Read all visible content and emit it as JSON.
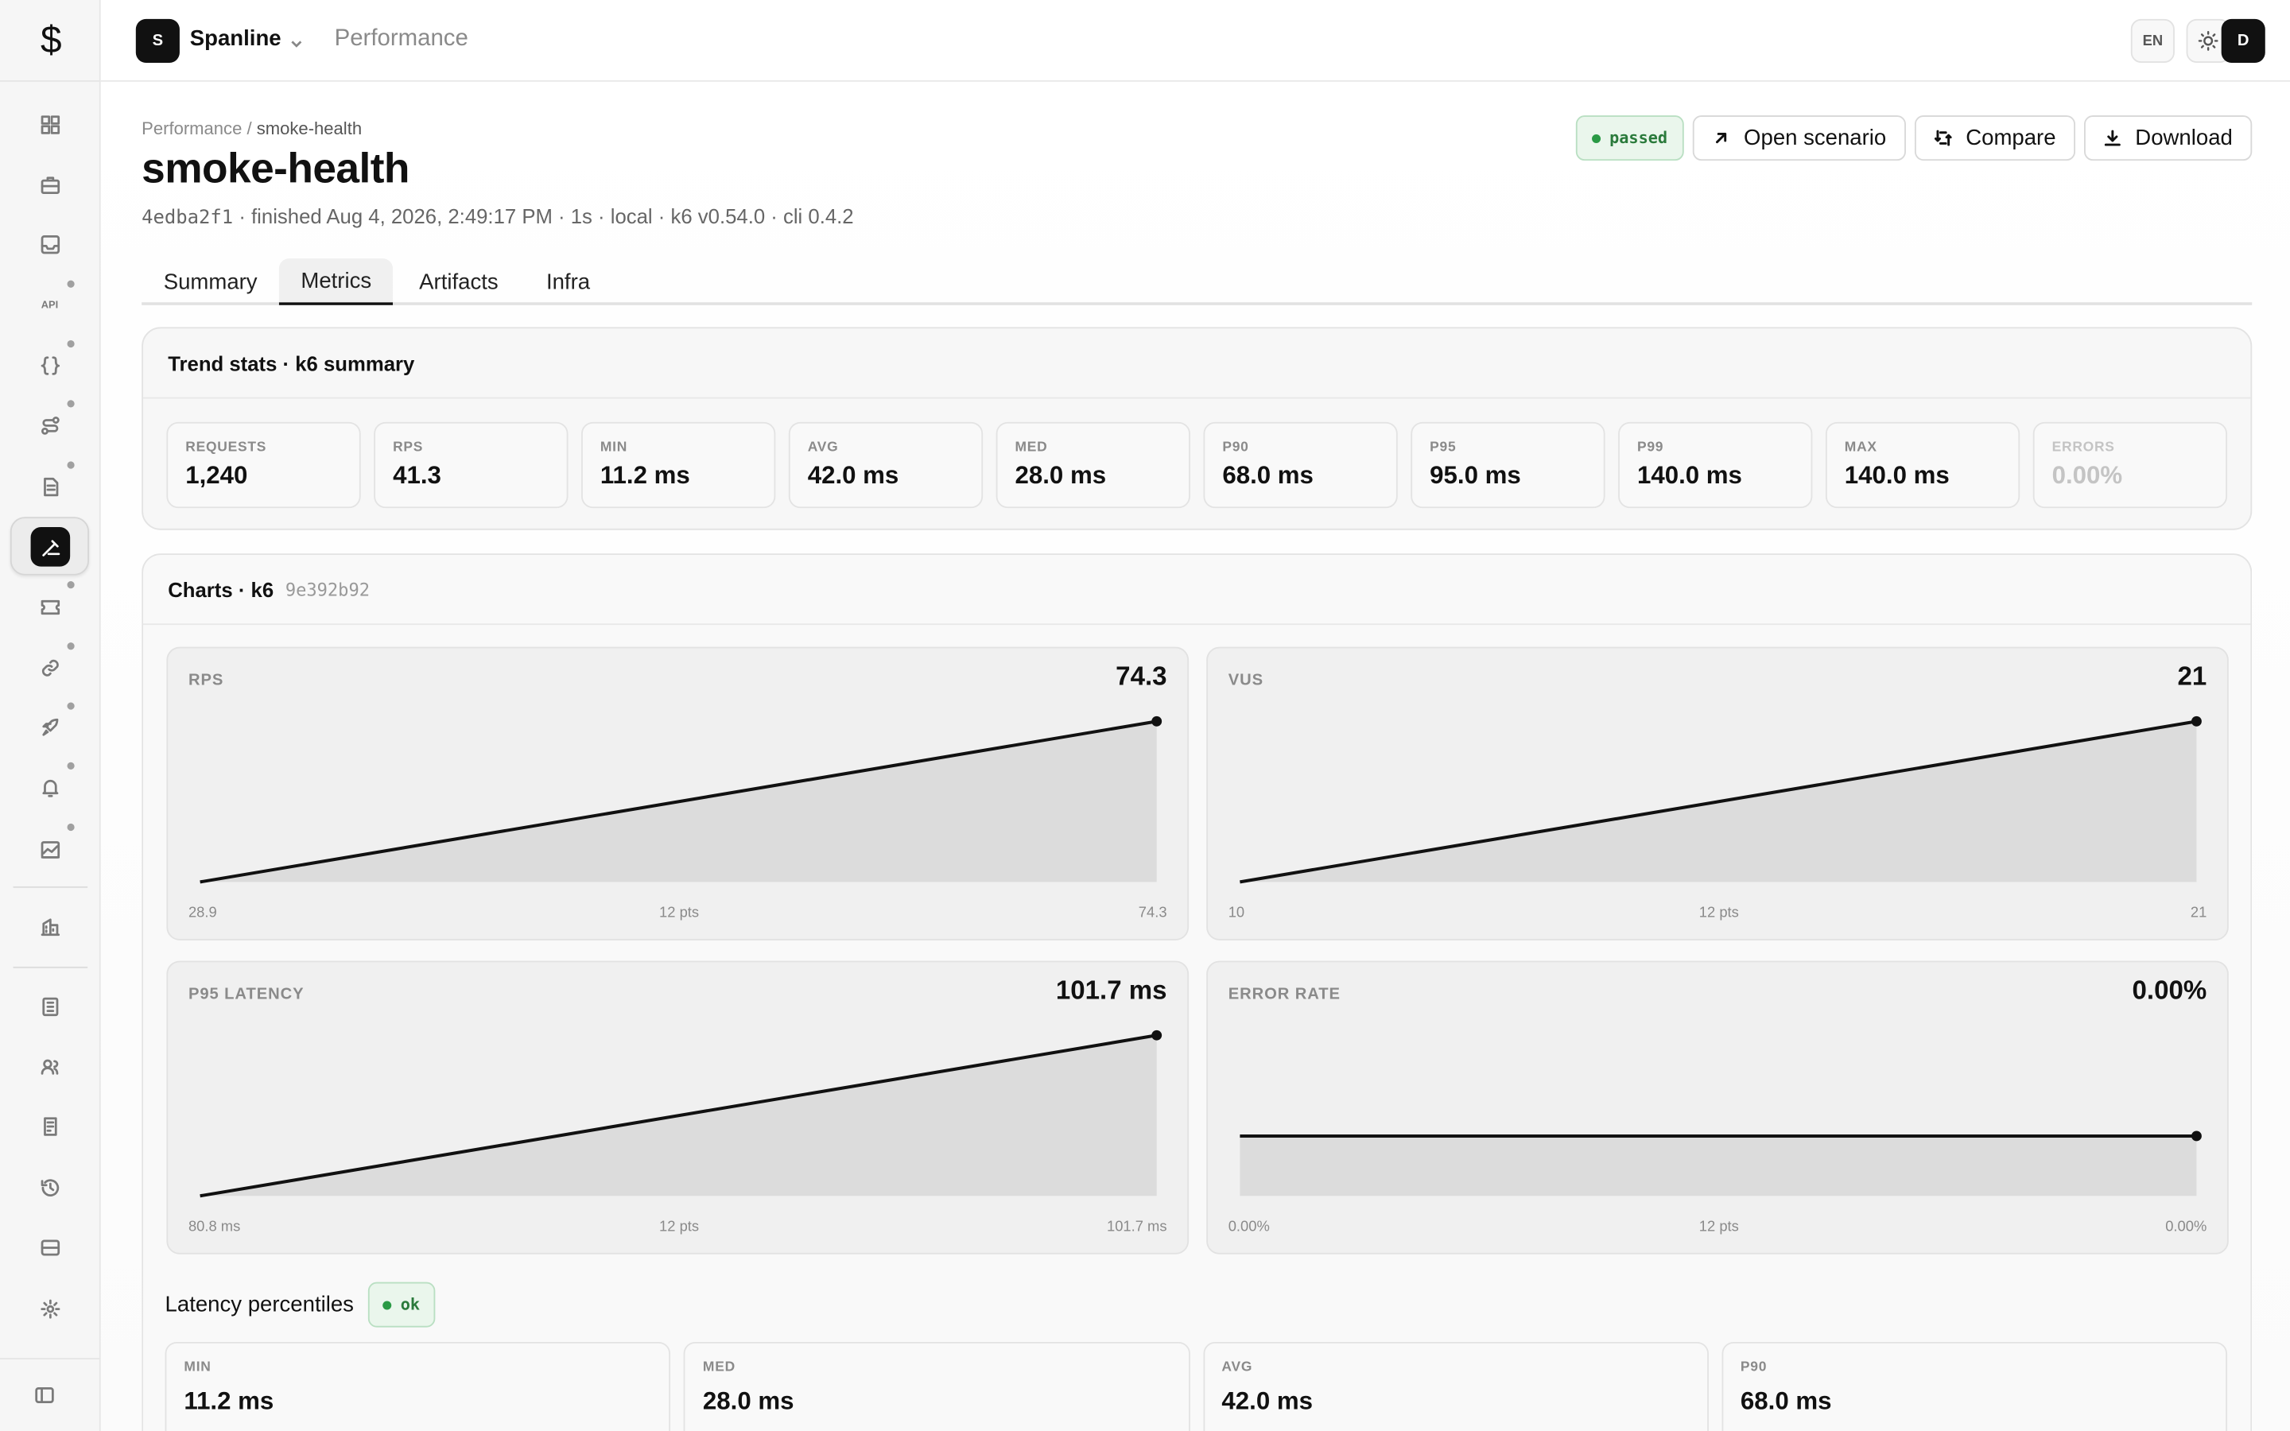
{
  "app": {
    "logo": "$",
    "workspace_initial": "S",
    "workspace": "Spanline",
    "section": "Performance"
  },
  "topbar": {
    "lang": "EN",
    "avatar": "D"
  },
  "sidebar": {
    "items": [
      {
        "name": "dashboard",
        "icon": "grid-icon"
      },
      {
        "name": "briefcase",
        "icon": "briefcase-icon"
      },
      {
        "name": "inbox",
        "icon": "inbox-icon"
      },
      {
        "name": "api",
        "icon": "api-icon",
        "label": "API"
      },
      {
        "name": "code",
        "icon": "braces-icon"
      },
      {
        "name": "workflow",
        "icon": "route-icon"
      },
      {
        "name": "docs",
        "icon": "file-icon"
      },
      {
        "name": "performance",
        "icon": "gauge-icon",
        "active": true
      },
      {
        "name": "tickets",
        "icon": "ticket-icon"
      },
      {
        "name": "links",
        "icon": "link-icon"
      },
      {
        "name": "deploy",
        "icon": "rocket-icon"
      },
      {
        "name": "alerts",
        "icon": "bell-icon"
      },
      {
        "name": "analytics",
        "icon": "chart-icon"
      },
      {
        "name": "buildings",
        "icon": "building-icon"
      },
      {
        "name": "ledger",
        "icon": "ledger-icon"
      },
      {
        "name": "users",
        "icon": "users-icon"
      },
      {
        "name": "reports",
        "icon": "report-icon"
      },
      {
        "name": "history",
        "icon": "history-icon"
      },
      {
        "name": "storage",
        "icon": "storage-icon"
      },
      {
        "name": "settings",
        "icon": "gear-icon"
      },
      {
        "name": "collapse",
        "icon": "sidebar-toggle-icon"
      }
    ]
  },
  "page": {
    "crumb_parent": "Performance",
    "crumb_sep": "/",
    "crumb_current": "smoke-health",
    "title": "smoke-health",
    "meta_hash": "4edba2f1",
    "meta_rest": " · finished Aug 4, 2026, 2:49:17 PM · 1s · local · k6 v0.54.0 · cli 0.4.2",
    "status": "passed",
    "actions": {
      "open": "Open scenario",
      "compare": "Compare",
      "download": "Download"
    },
    "tabs": [
      "Summary",
      "Metrics",
      "Artifacts",
      "Infra"
    ]
  },
  "trend": {
    "title": "Trend stats · k6 summary",
    "stats": [
      {
        "label": "REQUESTS",
        "value": "1,240"
      },
      {
        "label": "RPS",
        "value": "41.3"
      },
      {
        "label": "MIN",
        "value": "11.2 ms"
      },
      {
        "label": "AVG",
        "value": "42.0 ms"
      },
      {
        "label": "MED",
        "value": "28.0 ms"
      },
      {
        "label": "P90",
        "value": "68.0 ms"
      },
      {
        "label": "P95",
        "value": "95.0 ms"
      },
      {
        "label": "P99",
        "value": "140.0 ms"
      },
      {
        "label": "MAX",
        "value": "140.0 ms"
      },
      {
        "label": "ERRORS",
        "value": "0.00%"
      }
    ]
  },
  "charts": {
    "title": "Charts · k6",
    "hash": "9e392b92",
    "cards": [
      {
        "label": "RPS",
        "value": "74.3",
        "axis_min": "28.9",
        "axis_mid": "12 pts",
        "axis_max": "74.3",
        "start": 28.9,
        "end": 74.3
      },
      {
        "label": "VUS",
        "value": "21",
        "axis_min": "10",
        "axis_mid": "12 pts",
        "axis_max": "21",
        "start": 10,
        "end": 21
      },
      {
        "label": "P95 LATENCY",
        "value": "101.7 ms",
        "axis_min": "80.8 ms",
        "axis_mid": "12 pts",
        "axis_max": "101.7 ms",
        "start": 80.8,
        "end": 101.7
      },
      {
        "label": "ERROR RATE",
        "value": "0.00%",
        "axis_min": "0.00%",
        "axis_mid": "12 pts",
        "axis_max": "0.00%",
        "start": 0,
        "end": 0
      }
    ]
  },
  "latency": {
    "title": "Latency percentiles",
    "status": "ok",
    "items": [
      {
        "label": "MIN",
        "value": "11.2 ms"
      },
      {
        "label": "MED",
        "value": "28.0 ms"
      },
      {
        "label": "AVG",
        "value": "42.0 ms"
      },
      {
        "label": "P90",
        "value": "68.0 ms"
      }
    ]
  }
}
